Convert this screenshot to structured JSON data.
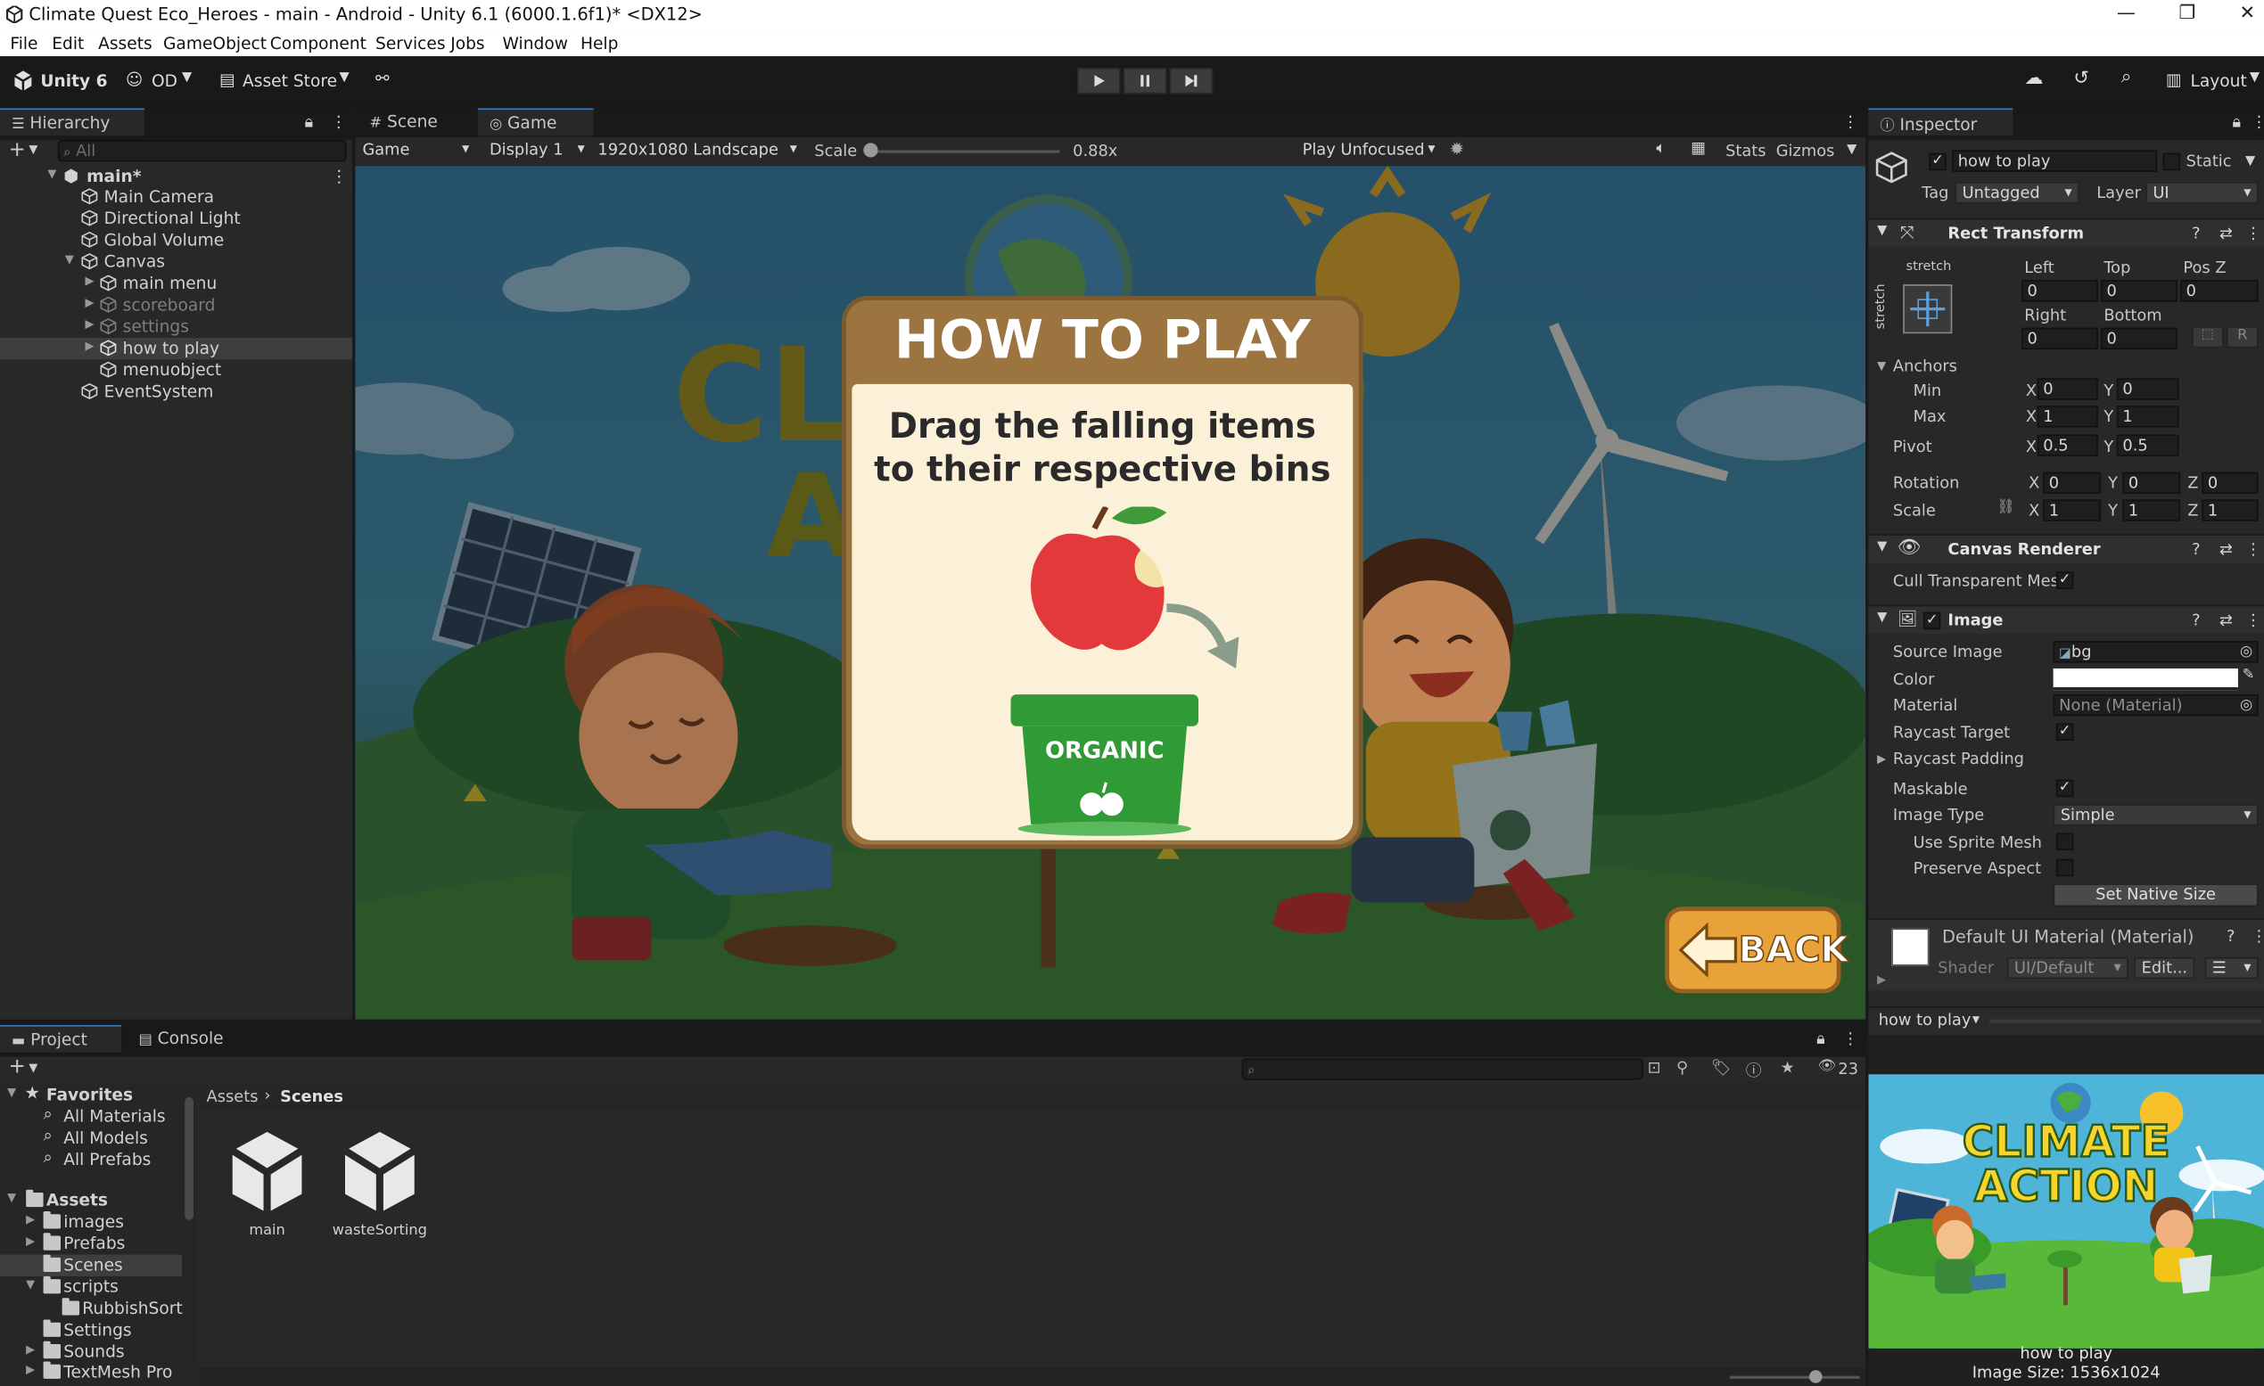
{
  "window": {
    "title": "Climate Quest Eco_Heroes - main - Android - Unity 6.1 (6000.1.6f1)* <DX12>"
  },
  "menu": [
    "File",
    "Edit",
    "Assets",
    "GameObject",
    "Component",
    "Services",
    "Jobs",
    "Window",
    "Help"
  ],
  "toolbar": {
    "unity": "Unity 6",
    "account": "OD",
    "asset_store": "Asset Store",
    "layout": "Layout"
  },
  "hierarchy": {
    "tab": "Hierarchy",
    "search_placeholder": "All",
    "scene": "main*",
    "items": [
      {
        "label": "Main Camera"
      },
      {
        "label": "Directional Light"
      },
      {
        "label": "Global Volume"
      },
      {
        "label": "Canvas"
      },
      {
        "label": "main menu"
      },
      {
        "label": "scoreboard"
      },
      {
        "label": "settings"
      },
      {
        "label": "how to play"
      },
      {
        "label": "menuobject"
      },
      {
        "label": "EventSystem"
      }
    ]
  },
  "game": {
    "tab_scene": "Scene",
    "tab_game": "Game",
    "mode": "Game",
    "display": "Display 1",
    "resolution": "1920x1080 Landscape",
    "scale_label": "Scale",
    "scale_value": "0.88x",
    "scale_fraction": 0.0,
    "play_mode": "Play Unfocused",
    "stats": "Stats",
    "gizmos": "Gizmos",
    "popup_title": "HOW TO PLAY",
    "popup_line1": "Drag the falling items",
    "popup_line2": "to their respective bins",
    "bin_label": "ORGANIC",
    "back_label": "BACK",
    "bg_title_1": "CLIMATE",
    "bg_title_2": "ACTION"
  },
  "inspector": {
    "tab": "Inspector",
    "object_name": "how to play",
    "static": "Static",
    "tag_label": "Tag",
    "tag": "Untagged",
    "layer_label": "Layer",
    "layer": "UI",
    "rect": {
      "title": "Rect Transform",
      "stretch": "stretch",
      "left_l": "Left",
      "top_l": "Top",
      "posz_l": "Pos Z",
      "left": "0",
      "top": "0",
      "posz": "0",
      "right_l": "Right",
      "bottom_l": "Bottom",
      "right": "0",
      "bottom": "0",
      "r_btn": "R",
      "anchors": "Anchors",
      "min": "Min",
      "max": "Max",
      "min_x": "0",
      "min_y": "0",
      "max_x": "1",
      "max_y": "1",
      "pivot": "Pivot",
      "pivot_x": "0.5",
      "pivot_y": "0.5",
      "rotation": "Rotation",
      "rot_x": "0",
      "rot_y": "0",
      "rot_z": "0",
      "scale": "Scale",
      "scale_x": "1",
      "scale_y": "1",
      "scale_z": "1",
      "x": "X",
      "y": "Y",
      "z": "Z"
    },
    "canvas_renderer": {
      "title": "Canvas Renderer",
      "cull": "Cull Transparent Mes"
    },
    "image": {
      "title": "Image",
      "source_image_l": "Source Image",
      "source_image": "bg",
      "color_l": "Color",
      "material_l": "Material",
      "material": "None (Material)",
      "raycast_target": "Raycast Target",
      "raycast_padding": "Raycast Padding",
      "maskable": "Maskable",
      "image_type_l": "Image Type",
      "image_type": "Simple",
      "use_sprite_mesh": "Use Sprite Mesh",
      "preserve_aspect": "Preserve Aspect",
      "set_native": "Set Native Size"
    },
    "material": {
      "title": "Default UI Material (Material)",
      "shader_l": "Shader",
      "shader": "UI/Default",
      "edit": "Edit..."
    },
    "preview": {
      "dropdown": "how to play",
      "name": "how to play",
      "size": "Image Size: 1536x1024"
    }
  },
  "project": {
    "tab_project": "Project",
    "tab_console": "Console",
    "count": "23",
    "favorites": "Favorites",
    "fav_items": [
      "All Materials",
      "All Models",
      "All Prefabs"
    ],
    "assets": "Assets",
    "folders": [
      "images",
      "Prefabs",
      "Scenes",
      "scripts",
      "RubbishSort",
      "Settings",
      "Sounds",
      "TextMesh Pro"
    ],
    "breadcrumb_root": "Assets",
    "breadcrumb_current": "Scenes",
    "files": [
      "main",
      "wasteSorting"
    ]
  },
  "colors": {
    "accent": "#3a79bb",
    "bg_dark": "#191919",
    "panel": "#282828",
    "popup_frame": "#9b7440",
    "popup_body": "#fbf1d8",
    "bin_green": "#2f9a36",
    "back_orange": "#e8a23a"
  }
}
